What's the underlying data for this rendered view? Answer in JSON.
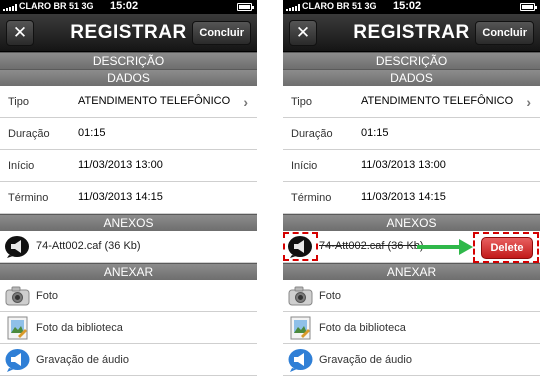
{
  "status": {
    "carrier": "CLARO BR 51  3G",
    "time": "15:02"
  },
  "nav": {
    "close_label": "✕",
    "title": "REGISTRAR",
    "done_label": "Concluir"
  },
  "sections": {
    "descricao": "DESCRIÇÃO",
    "dados": "DADOS",
    "anexos": "ANEXOS",
    "anexar": "ANEXAR"
  },
  "fields": [
    {
      "label": "Tipo",
      "value": "ATENDIMENTO TELEFÔNICO",
      "chevron": true
    },
    {
      "label": "Duração",
      "value": "01:15",
      "chevron": false
    },
    {
      "label": "Início",
      "value": "11/03/2013 13:00",
      "chevron": false
    },
    {
      "label": "Término",
      "value": "11/03/2013 14:15",
      "chevron": false
    }
  ],
  "attachment": {
    "name": "74-Att002.caf (36 Kb)",
    "icon": "megaphone-icon"
  },
  "actions": [
    {
      "label": "Foto",
      "icon": "camera-icon"
    },
    {
      "label": "Foto da biblioteca",
      "icon": "photo-library-icon"
    },
    {
      "label": "Gravação de áudio",
      "icon": "megaphone-icon"
    }
  ],
  "delete_label": "Delete",
  "colors": {
    "delete": "#d32f2f",
    "highlight": "#d40000",
    "arrow": "#2fb84a"
  }
}
